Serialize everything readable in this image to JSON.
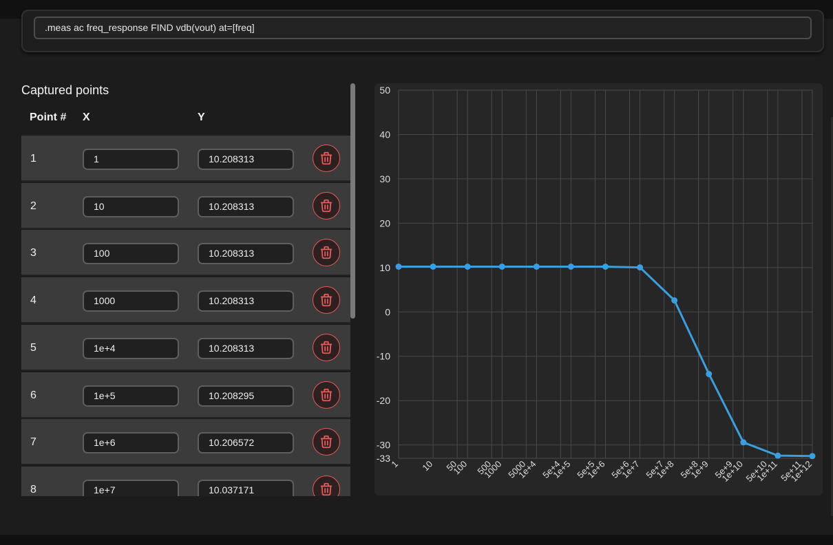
{
  "measurement": {
    "command": ".meas ac freq_response FIND vdb(vout) at=[freq]"
  },
  "points_panel": {
    "title": "Captured points",
    "columns": [
      "Point #",
      "X",
      "Y"
    ],
    "rows": [
      {
        "n": "1",
        "x": "1",
        "y": "10.208313"
      },
      {
        "n": "2",
        "x": "10",
        "y": "10.208313"
      },
      {
        "n": "3",
        "x": "100",
        "y": "10.208313"
      },
      {
        "n": "4",
        "x": "1000",
        "y": "10.208313"
      },
      {
        "n": "5",
        "x": "1e+4",
        "y": "10.208313"
      },
      {
        "n": "6",
        "x": "1e+5",
        "y": "10.208295"
      },
      {
        "n": "7",
        "x": "1e+6",
        "y": "10.206572"
      },
      {
        "n": "8",
        "x": "1e+7",
        "y": "10.037171"
      }
    ],
    "delete_icon": "trash-icon"
  },
  "colors": {
    "accent_line": "#3b9ede",
    "delete_red": "#e85a5a",
    "grid": "#4a4a4a"
  },
  "chart_data": {
    "type": "line",
    "x_scale": "log",
    "xlim": [
      1,
      1000000000000.0
    ],
    "ylim": [
      -33,
      50
    ],
    "y_ticks": [
      50,
      40,
      30,
      20,
      10,
      0,
      -10,
      -20,
      -30,
      -33
    ],
    "x_ticks": [
      {
        "v": 1,
        "label": "1"
      },
      {
        "v": 10,
        "label": "10"
      },
      {
        "v": 50,
        "label": "50"
      },
      {
        "v": 100,
        "label": "100"
      },
      {
        "v": 500,
        "label": "500"
      },
      {
        "v": 1000,
        "label": "1000"
      },
      {
        "v": 5000,
        "label": "5000"
      },
      {
        "v": 10000,
        "label": "1e+4"
      },
      {
        "v": 50000,
        "label": "5e+4"
      },
      {
        "v": 100000,
        "label": "1e+5"
      },
      {
        "v": 500000,
        "label": "5e+5"
      },
      {
        "v": 1000000,
        "label": "1e+6"
      },
      {
        "v": 5000000,
        "label": "5e+6"
      },
      {
        "v": 10000000,
        "label": "1e+7"
      },
      {
        "v": 50000000,
        "label": "5e+7"
      },
      {
        "v": 100000000,
        "label": "1e+8"
      },
      {
        "v": 500000000,
        "label": "5e+8"
      },
      {
        "v": 1000000000,
        "label": "1e+9"
      },
      {
        "v": 5000000000,
        "label": "5e+9"
      },
      {
        "v": 10000000000,
        "label": "1e+10"
      },
      {
        "v": 50000000000,
        "label": "5e+10"
      },
      {
        "v": 100000000000,
        "label": "1e+11"
      },
      {
        "v": 500000000000,
        "label": "5e+11"
      },
      {
        "v": 1000000000000,
        "label": "1e+12"
      }
    ],
    "grid": true,
    "series": [
      {
        "x": [
          1,
          10,
          100,
          1000,
          10000,
          100000,
          1000000,
          10000000,
          100000000,
          1000000000,
          10000000000,
          100000000000,
          1000000000000
        ],
        "y": [
          10.208313,
          10.208313,
          10.208313,
          10.208313,
          10.208313,
          10.208295,
          10.206572,
          10.037171,
          2.6,
          -14.0,
          -29.4,
          -32.4,
          -32.5
        ]
      }
    ]
  }
}
